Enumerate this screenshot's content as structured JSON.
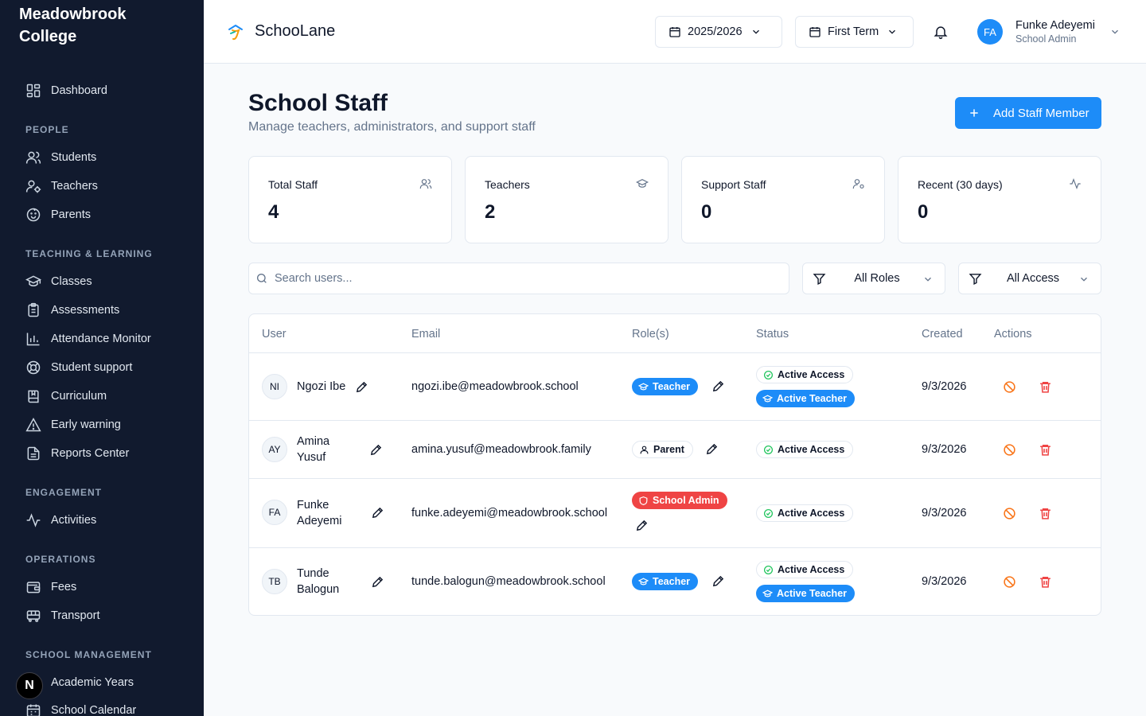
{
  "sidebar": {
    "school_name": "Meadowbrook College",
    "dashboard": "Dashboard",
    "sections": {
      "people": "PEOPLE",
      "teaching": "TEACHING & LEARNING",
      "engagement": "ENGAGEMENT",
      "operations": "OPERATIONS",
      "management": "SCHOOL MANAGEMENT"
    },
    "items": {
      "students": "Students",
      "teachers": "Teachers",
      "parents": "Parents",
      "classes": "Classes",
      "assessments": "Assessments",
      "attendance": "Attendance Monitor",
      "support": "Student support",
      "curriculum": "Curriculum",
      "early_warning": "Early warning",
      "reports": "Reports Center",
      "activities": "Activities",
      "fees": "Fees",
      "transport": "Transport",
      "academic_years": "Academic Years",
      "calendar": "School Calendar"
    },
    "badge": "N"
  },
  "header": {
    "app_name": "SchooLane",
    "year": "2025/2026",
    "term": "First Term",
    "user_initials": "FA",
    "user_name": "Funke Adeyemi",
    "user_role": "School Admin"
  },
  "page": {
    "title": "School Staff",
    "subtitle": "Manage teachers, administrators, and support staff",
    "add_button": "Add Staff Member"
  },
  "stats": [
    {
      "label": "Total Staff",
      "value": "4",
      "icon": "users-icon"
    },
    {
      "label": "Teachers",
      "value": "2",
      "icon": "graduation-cap-icon"
    },
    {
      "label": "Support Staff",
      "value": "0",
      "icon": "user-cog-icon"
    },
    {
      "label": "Recent (30 days)",
      "value": "0",
      "icon": "activity-icon"
    }
  ],
  "filters": {
    "search_placeholder": "Search users...",
    "roles": "All Roles",
    "access": "All Access"
  },
  "table": {
    "headers": {
      "user": "User",
      "email": "Email",
      "roles": "Role(s)",
      "status": "Status",
      "created": "Created",
      "actions": "Actions"
    },
    "rows": [
      {
        "initials": "NI",
        "name": "Ngozi Ibe",
        "email": "ngozi.ibe@meadowbrook.school",
        "role": "Teacher",
        "status": [
          "Active Access",
          "Active Teacher"
        ],
        "created": "9/3/2026"
      },
      {
        "initials": "AY",
        "name": "Amina Yusuf",
        "email": "amina.yusuf@meadowbrook.family",
        "role": "Parent",
        "status": [
          "Active Access"
        ],
        "created": "9/3/2026"
      },
      {
        "initials": "FA",
        "name": "Funke Adeyemi",
        "email": "funke.adeyemi@meadowbrook.school",
        "role": "School Admin",
        "status": [
          "Active Access"
        ],
        "created": "9/3/2026"
      },
      {
        "initials": "TB",
        "name": "Tunde Balogun",
        "email": "tunde.balogun@meadowbrook.school",
        "role": "Teacher",
        "status": [
          "Active Access",
          "Active Teacher"
        ],
        "created": "9/3/2026"
      }
    ]
  },
  "colors": {
    "primary": "#1d8cf8",
    "sidebar_bg": "#111a2e",
    "danger": "#ef4444",
    "warning": "#f97316",
    "success": "#22c55e"
  }
}
